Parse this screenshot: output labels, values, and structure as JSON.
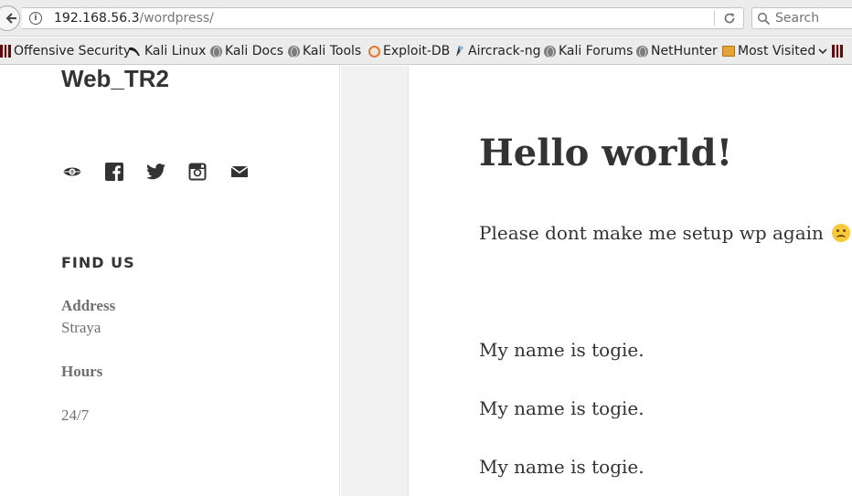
{
  "browser": {
    "url_host": "192.168.56.3",
    "url_path": "/wordpress/",
    "search_placeholder": "Search",
    "bookmarks": [
      {
        "label": "Offensive Security",
        "icon": "offensive-security-icon"
      },
      {
        "label": "Kali Linux",
        "icon": "kali-dragon-icon"
      },
      {
        "label": "Kali Docs",
        "icon": "globe-icon"
      },
      {
        "label": "Kali Tools",
        "icon": "globe-icon"
      },
      {
        "label": "Exploit-DB",
        "icon": "exploit-db-icon"
      },
      {
        "label": "Aircrack-ng",
        "icon": "aircrack-icon"
      },
      {
        "label": "Kali Forums",
        "icon": "globe-icon"
      },
      {
        "label": "NetHunter",
        "icon": "globe-icon"
      },
      {
        "label": "Most Visited",
        "icon": "folder-icon"
      }
    ]
  },
  "site": {
    "title": "Web_TR2",
    "social_icons": [
      "wordpress-icon",
      "facebook-icon",
      "twitter-icon",
      "instagram-icon",
      "email-icon"
    ]
  },
  "widget": {
    "title": "FIND US",
    "address_label": "Address",
    "address_value": "Straya",
    "hours_label": "Hours",
    "hours_value": "24/7"
  },
  "post": {
    "title": "Hello world!",
    "intro": "Please dont make me setup wp again",
    "intro_emoji": "frowning-face-emoji",
    "paragraphs": [
      "My name is togie.",
      "My name is togie.",
      "My name is togie."
    ]
  },
  "colors": {
    "text": "#333333",
    "muted": "#707070",
    "gutter": "#f1f1f1",
    "chrome": "#ececec"
  }
}
